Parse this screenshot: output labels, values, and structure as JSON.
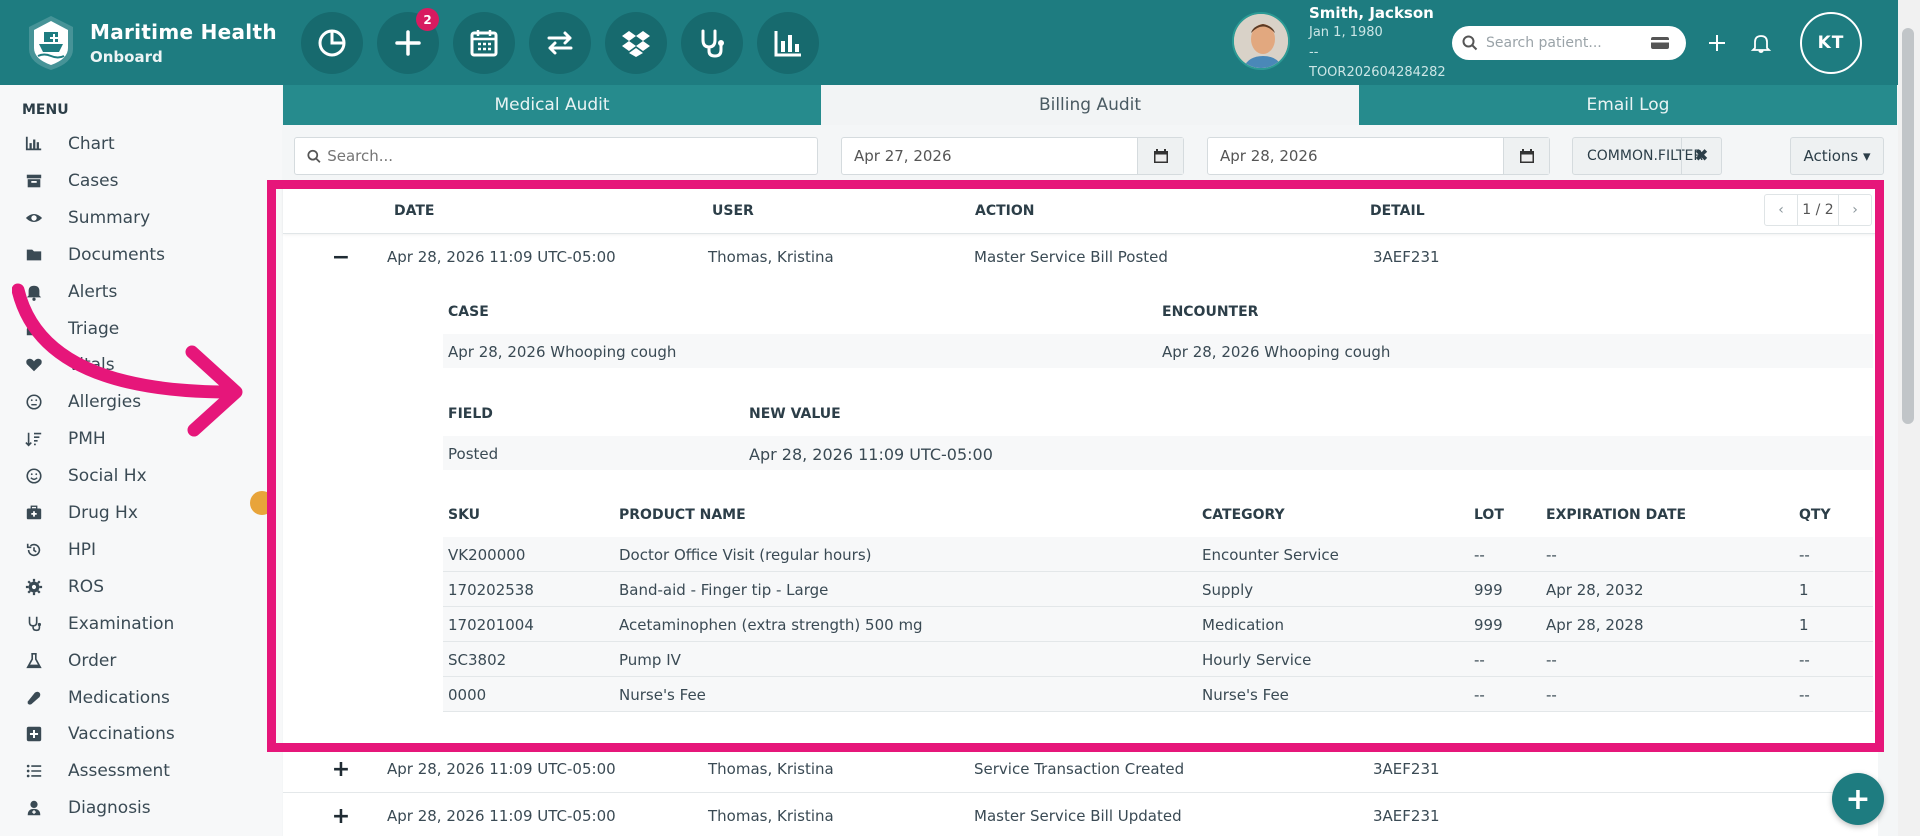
{
  "brand": {
    "name": "Maritime Health",
    "subtitle": "Onboard"
  },
  "toolbar": {
    "add_badge": "2"
  },
  "patient": {
    "name": "Smith, Jackson",
    "dob": "Jan 1, 1980",
    "extra": "--",
    "id": "TOOR202604284282"
  },
  "search": {
    "placeholder": "Search patient..."
  },
  "user": {
    "initials": "KT"
  },
  "sidebar": {
    "title": "MENU",
    "items": [
      {
        "label": "Chart",
        "icon": "bar-chart-icon"
      },
      {
        "label": "Cases",
        "icon": "archive-icon"
      },
      {
        "label": "Summary",
        "icon": "eye-icon"
      },
      {
        "label": "Documents",
        "icon": "folder-icon"
      },
      {
        "label": "Alerts",
        "icon": "bell-icon"
      },
      {
        "label": "Triage",
        "icon": "inbox-icon"
      },
      {
        "label": "Vitals",
        "icon": "heart-icon"
      },
      {
        "label": "Allergies",
        "icon": "face-icon"
      },
      {
        "label": "PMH",
        "icon": "sort-icon"
      },
      {
        "label": "Social Hx",
        "icon": "smile-icon"
      },
      {
        "label": "Drug Hx",
        "icon": "medkit-icon"
      },
      {
        "label": "HPI",
        "icon": "history-icon"
      },
      {
        "label": "ROS",
        "icon": "gear-icon"
      },
      {
        "label": "Examination",
        "icon": "stethoscope-icon"
      },
      {
        "label": "Order",
        "icon": "flask-icon"
      },
      {
        "label": "Medications",
        "icon": "pill-icon"
      },
      {
        "label": "Vaccinations",
        "icon": "plus-square-icon"
      },
      {
        "label": "Assessment",
        "icon": "list-icon"
      },
      {
        "label": "Diagnosis",
        "icon": "user-md-icon"
      }
    ]
  },
  "tabs": [
    {
      "label": "Medical Audit",
      "active": false
    },
    {
      "label": "Billing Audit",
      "active": true
    },
    {
      "label": "Email Log",
      "active": false
    }
  ],
  "filters": {
    "search_placeholder": "Search...",
    "date_from": "Apr 27, 2026",
    "date_to": "Apr 28, 2026",
    "common_filter": "COMMON.FILTER",
    "clear": "✖",
    "actions": "Actions ▾"
  },
  "table": {
    "headers": {
      "date": "DATE",
      "user": "USER",
      "action": "ACTION",
      "detail": "DETAIL"
    },
    "pager": {
      "prev": "‹",
      "current": "1 / 2",
      "next": "›"
    },
    "expanded_row": {
      "toggle": "−",
      "date": "Apr 28, 2026 11:09 UTC-05:00",
      "user": "Thomas, Kristina",
      "action": "Master Service Bill Posted",
      "detail": "3AEF231"
    },
    "case_section": {
      "case_header": "CASE",
      "encounter_header": "ENCOUNTER",
      "case_value": "Apr 28, 2026 Whooping cough",
      "encounter_value": "Apr 28, 2026 Whooping cough"
    },
    "field_section": {
      "field_header": "FIELD",
      "new_value_header": "NEW VALUE",
      "field_value": "Posted",
      "new_value": "Apr 28, 2026 11:09 UTC-05:00"
    },
    "products": {
      "headers": {
        "sku": "SKU",
        "name": "PRODUCT NAME",
        "category": "CATEGORY",
        "lot": "LOT",
        "exp": "EXPIRATION DATE",
        "qty": "QTY"
      },
      "rows": [
        {
          "sku": "VK200000",
          "name": "Doctor Office Visit (regular hours)",
          "category": "Encounter Service",
          "lot": "--",
          "exp": "--",
          "qty": "--"
        },
        {
          "sku": "170202538",
          "name": "Band-aid - Finger tip - Large",
          "category": "Supply",
          "lot": "999",
          "exp": "Apr 28, 2032",
          "qty": "1"
        },
        {
          "sku": "170201004",
          "name": "Acetaminophen (extra strength) 500 mg",
          "category": "Medication",
          "lot": "999",
          "exp": "Apr 28, 2028",
          "qty": "1"
        },
        {
          "sku": "SC3802",
          "name": "Pump IV",
          "category": "Hourly Service",
          "lot": "--",
          "exp": "--",
          "qty": "--"
        },
        {
          "sku": "0000",
          "name": "Nurse's Fee",
          "category": "Nurse's Fee",
          "lot": "--",
          "exp": "--",
          "qty": "--"
        }
      ]
    },
    "other_rows": [
      {
        "toggle": "+",
        "date": "Apr 28, 2026 11:09 UTC-05:00",
        "user": "Thomas, Kristina",
        "action": "Service Transaction Created",
        "detail": "3AEF231"
      },
      {
        "toggle": "+",
        "date": "Apr 28, 2026 11:09 UTC-05:00",
        "user": "Thomas, Kristina",
        "action": "Master Service Bill Updated",
        "detail": "3AEF231"
      }
    ]
  },
  "fab": {
    "label": "+"
  },
  "colors": {
    "primary": "#1e7c80",
    "highlight": "#e6167a",
    "badge": "#d81b60"
  }
}
